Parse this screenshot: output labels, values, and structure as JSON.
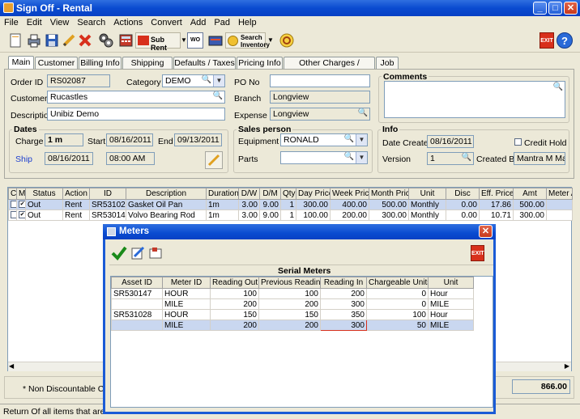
{
  "window": {
    "title": "Sign Off - Rental"
  },
  "menu": [
    "File",
    "Edit",
    "View",
    "Search",
    "Actions",
    "Convert",
    "Add",
    "Pad",
    "Help"
  ],
  "toolbar": {
    "sub_rent": "Sub Rent",
    "wo": "WO",
    "search_inventory_line1": "Search",
    "search_inventory_line2": "Inventory",
    "exit": "EXIT"
  },
  "tabs": [
    "Main",
    "Customer",
    "Billing Info",
    "Shipping Info",
    "Defaults / Taxes",
    "Pricing Info",
    "Other Charges / Summary",
    "Job"
  ],
  "main": {
    "order_id_label": "Order ID",
    "order_id": "RS02087",
    "category_label": "Category",
    "category": "DEMO",
    "customer_label": "Customer",
    "customer": "Rucastles",
    "description_label": "Description",
    "description": "Unibiz Demo",
    "po_label": "PO No",
    "po": "",
    "branch_label": "Branch",
    "branch": "Longview",
    "expense_label": "Expense",
    "expense": "Longview",
    "comments_label": "Comments",
    "dates_label": "Dates",
    "charge_label": "Charge",
    "charge": "1 m",
    "start_label": "Start",
    "start": "08/16/2011",
    "end_label": "End",
    "end": "09/13/2011",
    "ship_label": "Ship",
    "ship_date": "08/16/2011",
    "ship_time": "08:00 AM",
    "sales_label": "Sales person",
    "equipment_label": "Equipment",
    "equipment": "RONALD",
    "parts_label": "Parts",
    "parts": "",
    "info_label": "Info",
    "date_created_label": "Date Created",
    "date_created": "08/16/2011",
    "credit_hold_label": "Credit Hold",
    "version_label": "Version",
    "version": "1",
    "created_by_label": "Created By",
    "created_by": "Mantra M Mantra"
  },
  "items_grid": {
    "headers": [
      "C",
      "M",
      "Status",
      "Action",
      "ID",
      "Description",
      "Duration",
      "D/W",
      "D/M",
      "Qty",
      "Day Price",
      "Week Price",
      "Month Price",
      "Unit",
      "Disc",
      "Eff. Price",
      "Amt",
      "Meter A"
    ],
    "rows": [
      [
        "",
        "✔",
        "Out",
        "Rent",
        "SR531028",
        "Gasket Oil Pan",
        "1m",
        "3.00",
        "9.00",
        "1",
        "300.00",
        "400.00",
        "500.00",
        "Monthly",
        "0.00",
        "17.86",
        "500.00",
        ""
      ],
      [
        "",
        "✔",
        "Out",
        "Rent",
        "SR530147",
        "Volvo Bearing Rod",
        "1m",
        "3.00",
        "9.00",
        "1",
        "100.00",
        "200.00",
        "300.00",
        "Monthly",
        "0.00",
        "10.71",
        "300.00",
        ""
      ]
    ]
  },
  "footer": {
    "non_discountable": "* Non Discountable  C - C",
    "total": "866.00"
  },
  "status_bar": "Return Of all items that are out i",
  "meters_dialog": {
    "title": "Meters",
    "exit": "EXIT",
    "section_title": "Serial Meters",
    "headers": [
      "Asset ID",
      "Meter ID",
      "Reading Out",
      "Previous Reading",
      "Reading In",
      "Chargeable Units",
      "Unit"
    ],
    "rows": [
      [
        "SR530147",
        "HOUR",
        "100",
        "100",
        "200",
        "0",
        "Hour"
      ],
      [
        "",
        "MILE",
        "200",
        "200",
        "300",
        "0",
        "MILE"
      ],
      [
        "SR531028",
        "HOUR",
        "150",
        "150",
        "350",
        "100",
        "Hour"
      ],
      [
        "",
        "MILE",
        "200",
        "200",
        "300",
        "50",
        "MILE"
      ]
    ]
  },
  "colors": {
    "title_blue": "#0a4bd0",
    "selected_row": "#c9d7f0",
    "link_blue": "#1d3fcf",
    "exit_red": "#d8301c"
  }
}
